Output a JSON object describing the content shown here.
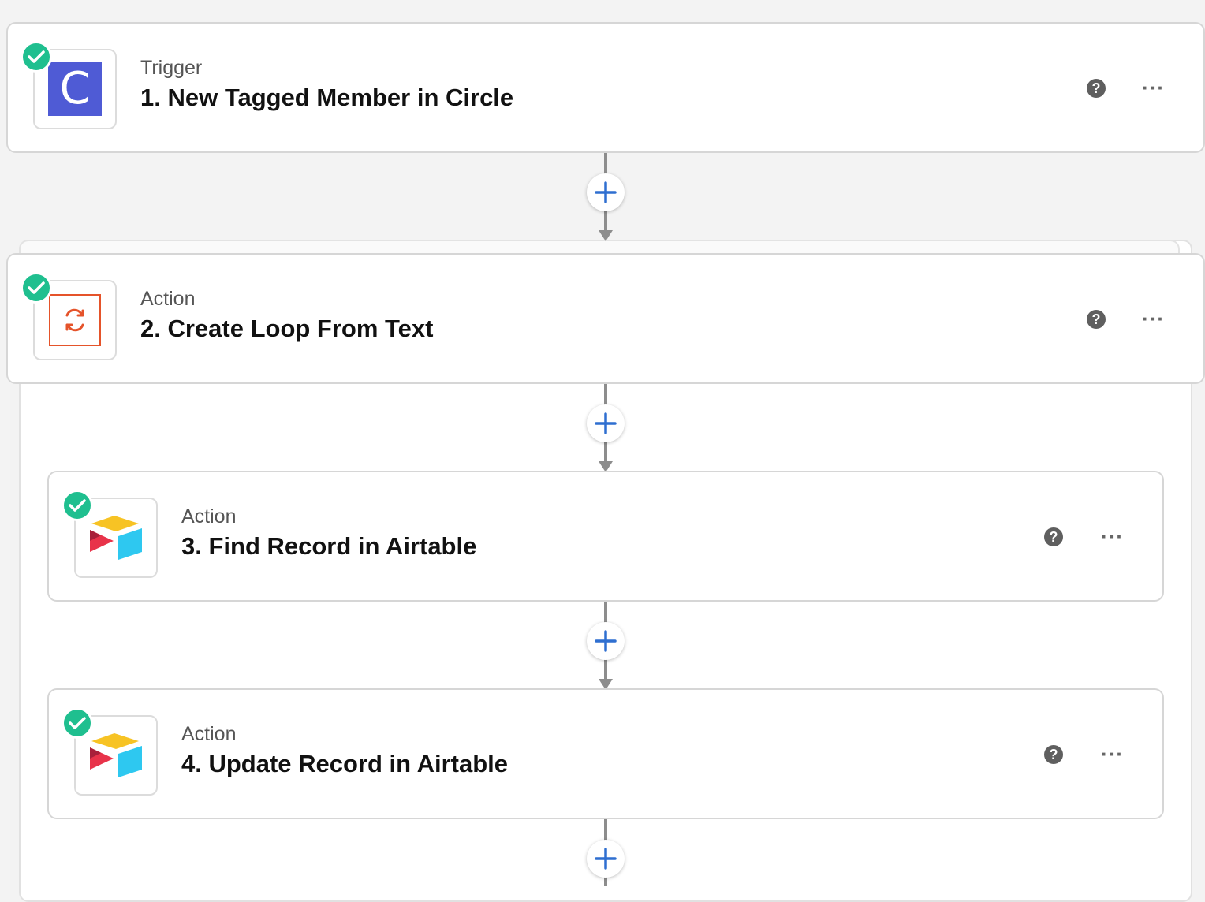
{
  "steps": [
    {
      "kind": "Trigger",
      "title": "1. New Tagged Member in Circle",
      "app_icon": "circle-app-icon",
      "status_icon": "check-icon"
    },
    {
      "kind": "Action",
      "title": "2. Create Loop From Text",
      "app_icon": "loop-app-icon",
      "status_icon": "check-icon"
    },
    {
      "kind": "Action",
      "title": "3. Find Record in Airtable",
      "app_icon": "airtable-app-icon",
      "status_icon": "check-icon"
    },
    {
      "kind": "Action",
      "title": "4. Update Record in Airtable",
      "app_icon": "airtable-app-icon",
      "status_icon": "check-icon"
    }
  ],
  "help_label": "?",
  "more_label": "···",
  "circle_letter": "C",
  "colors": {
    "check": "#1fbf8f",
    "circle_brand": "#4f5bd5",
    "loop_brand": "#e5532a",
    "plus": "#2f6fd0",
    "airtable_yellow": "#f7c324",
    "airtable_red": "#e8334a",
    "airtable_blue": "#2ec8f0"
  }
}
